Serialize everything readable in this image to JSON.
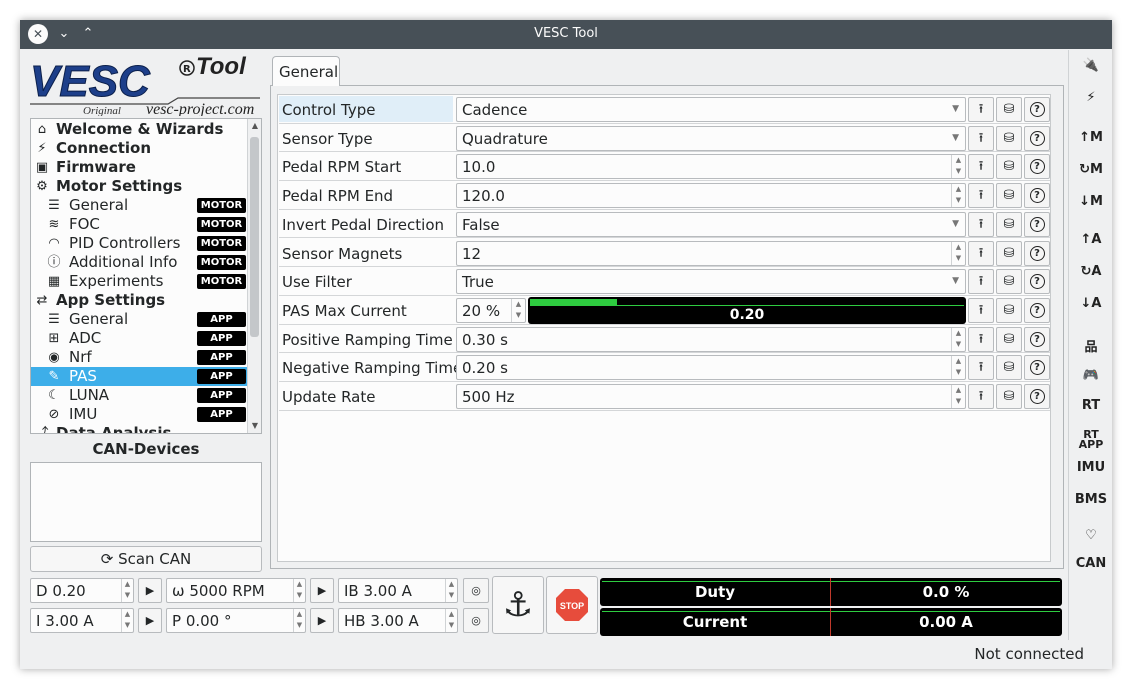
{
  "window": {
    "title": "VESC Tool"
  },
  "logo": {
    "brand": "VESC",
    "tool": "Tool",
    "original": "Original",
    "site": "vesc-project.com"
  },
  "sidebar": {
    "items": [
      {
        "label": "Welcome & Wizards",
        "icon": "home-icon",
        "header": true
      },
      {
        "label": "Connection",
        "icon": "plug-icon",
        "header": true
      },
      {
        "label": "Firmware",
        "icon": "chip-icon",
        "header": true
      },
      {
        "label": "Motor Settings",
        "icon": "motor-icon",
        "header": true
      },
      {
        "label": "General",
        "icon": "sliders-icon",
        "badge": "MOTOR"
      },
      {
        "label": "FOC",
        "icon": "coil-icon",
        "badge": "MOTOR"
      },
      {
        "label": "PID Controllers",
        "icon": "gauge-icon",
        "badge": "MOTOR"
      },
      {
        "label": "Additional Info",
        "icon": "info-icon",
        "badge": "MOTOR"
      },
      {
        "label": "Experiments",
        "icon": "calculator-icon",
        "badge": "MOTOR"
      },
      {
        "label": "App Settings",
        "icon": "app-settings-icon",
        "header": true
      },
      {
        "label": "General",
        "icon": "sliders-icon",
        "badge": "APP"
      },
      {
        "label": "ADC",
        "icon": "adc-icon",
        "badge": "APP"
      },
      {
        "label": "Nrf",
        "icon": "radio-icon",
        "badge": "APP"
      },
      {
        "label": "PAS",
        "icon": "wrench-icon",
        "badge": "APP",
        "selected": true
      },
      {
        "label": "LUNA",
        "icon": "moon-icon",
        "badge": "APP"
      },
      {
        "label": "IMU",
        "icon": "imu-icon",
        "badge": "APP"
      },
      {
        "label": "Data Analysis",
        "icon": "chart-icon",
        "header": true
      }
    ]
  },
  "can": {
    "title": "CAN-Devices",
    "scan_label": "Scan CAN"
  },
  "tabs": [
    {
      "label": "General"
    }
  ],
  "params": [
    {
      "name": "Control Type",
      "value": "Cadence",
      "kind": "combo"
    },
    {
      "name": "Sensor Type",
      "value": "Quadrature",
      "kind": "combo"
    },
    {
      "name": "Pedal RPM Start",
      "value": "10.0",
      "kind": "spin"
    },
    {
      "name": "Pedal RPM End",
      "value": "120.0",
      "kind": "spin"
    },
    {
      "name": "Invert Pedal Direction",
      "value": "False",
      "kind": "combo"
    },
    {
      "name": "Sensor Magnets",
      "value": "12",
      "kind": "spin"
    },
    {
      "name": "Use Filter",
      "value": "True",
      "kind": "combo"
    },
    {
      "name": "PAS Max Current",
      "value": "20 %",
      "kind": "bar",
      "bar_value": "0.20",
      "bar_fraction": 0.2
    },
    {
      "name": "Positive Ramping Time",
      "value": "0.30 s",
      "kind": "spin"
    },
    {
      "name": "Negative Ramping Time",
      "value": "0.20 s",
      "kind": "spin"
    },
    {
      "name": "Update Rate",
      "value": "500 Hz",
      "kind": "spin"
    }
  ],
  "right_toolbar": [
    "↑M",
    "↻M",
    "↓M",
    "↑A",
    "↻A",
    "↓A",
    "RT",
    "RT APP",
    "IMU",
    "BMS",
    "CAN"
  ],
  "controls": {
    "duty": "D 0.20",
    "rpm": "ω 5000 RPM",
    "ib": "IB 3.00 A",
    "current": "I 3.00 A",
    "pos": "P 0.00 °",
    "hb": "HB 3.00 A",
    "stop_label": "STOP"
  },
  "gauges": [
    {
      "label": "Duty",
      "value": "0.0 %"
    },
    {
      "label": "Current",
      "value": "0.00 A"
    }
  ],
  "status": {
    "text": "Not connected"
  },
  "colors": {
    "selection": "#3daee9",
    "badge_bg": "#000000",
    "bar_green": "#2ecc40",
    "stop_red": "#e74c3c"
  }
}
